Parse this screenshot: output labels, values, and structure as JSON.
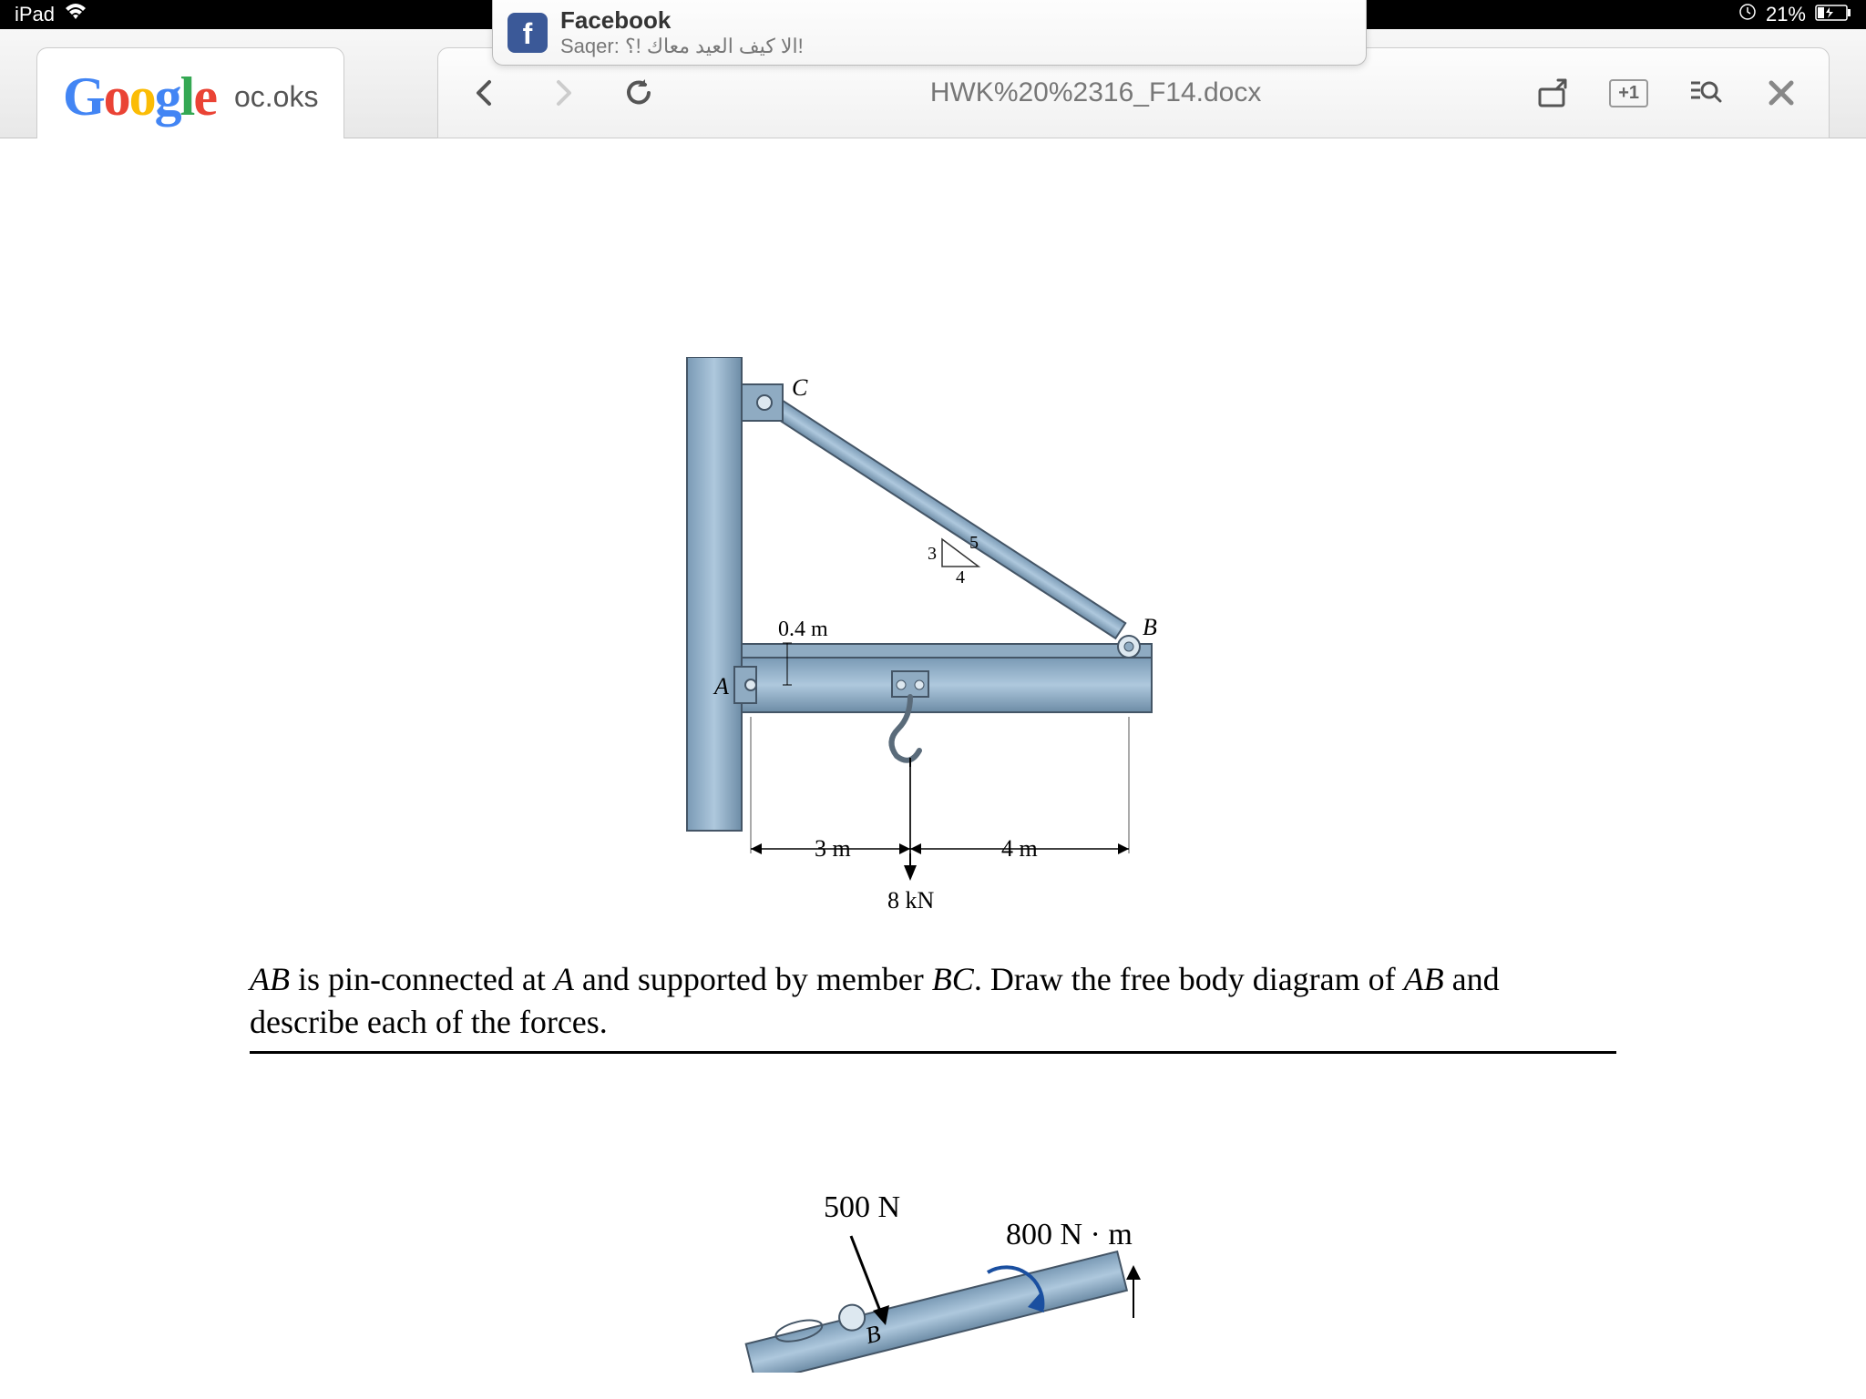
{
  "status": {
    "device": "iPad",
    "battery": "21%"
  },
  "tabs": {
    "google_partial": "oc.oks"
  },
  "navigation": {
    "url": "HWK%20%2316_F14.docx",
    "plus_one": "+1"
  },
  "notification": {
    "app": "Facebook",
    "message": "Saqer: الا كيف العيد معاك !؟!"
  },
  "diagram": {
    "point_A": "A",
    "point_B": "B",
    "point_C": "C",
    "dim_04m": "0.4 m",
    "dim_3m": "3 m",
    "dim_4m": "4 m",
    "tri_3": "3",
    "tri_4": "4",
    "tri_5": "5",
    "load": "8 kN"
  },
  "problem": {
    "text_1": "AB",
    "text_2": " is pin-connected at ",
    "text_3": "A",
    "text_4": " and supported by member ",
    "text_5": "BC",
    "text_6": ".  Draw the free body diagram of ",
    "text_7": "AB",
    "text_8": " and describe each of the forces."
  },
  "second_fig": {
    "force_500": "500 N",
    "moment_800": "800 N · m",
    "point_B": "B"
  }
}
